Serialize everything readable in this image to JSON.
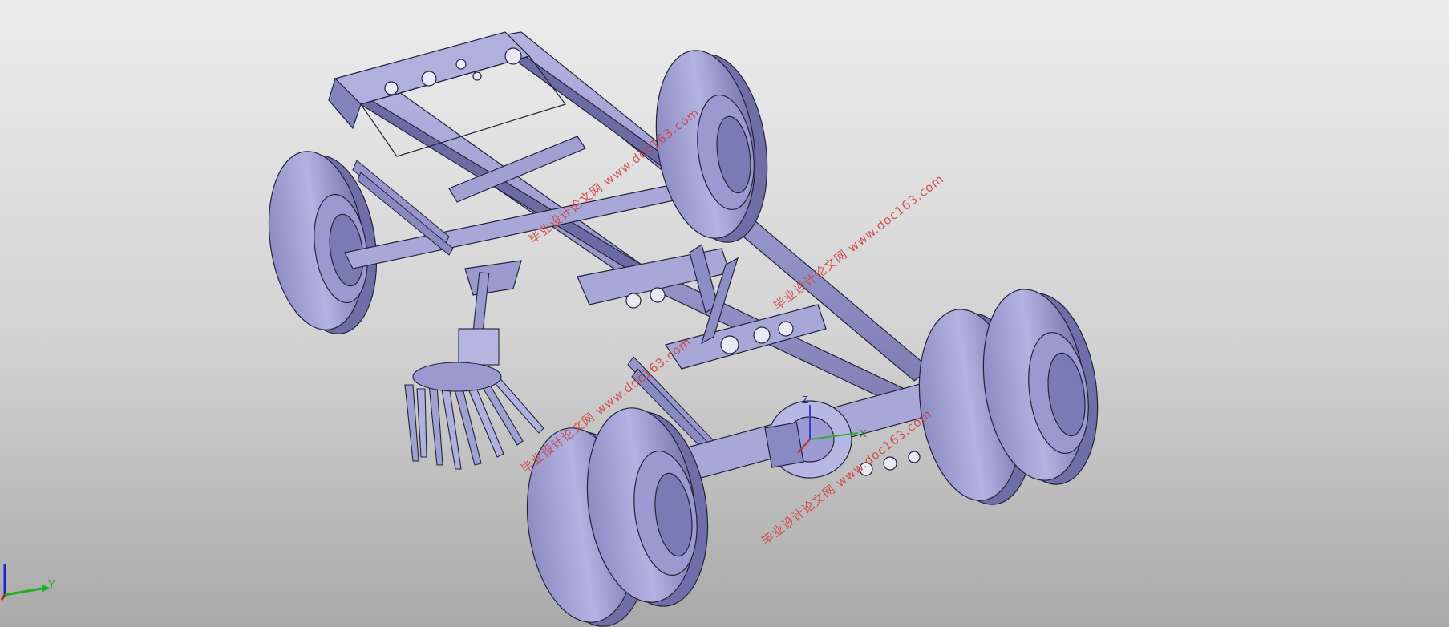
{
  "viewport": {
    "background_top": "#ececec",
    "background_bottom": "#a9a9a9",
    "model_color": "#a4a4d6",
    "edge_color": "#23233a"
  },
  "watermarks": [
    {
      "cn": "毕业设计论文网",
      "url": "www.doc163.com"
    },
    {
      "cn": "毕业设计论文网",
      "url": "www.doc163.com"
    },
    {
      "cn": "毕业设计论文网",
      "url": "www.doc163.com"
    },
    {
      "cn": "毕业设计论文网",
      "url": "www.doc163.com"
    }
  ],
  "model_triad": {
    "z_label": "Z",
    "x_label": "X"
  },
  "corner_triad": {
    "y_label": "Y"
  }
}
